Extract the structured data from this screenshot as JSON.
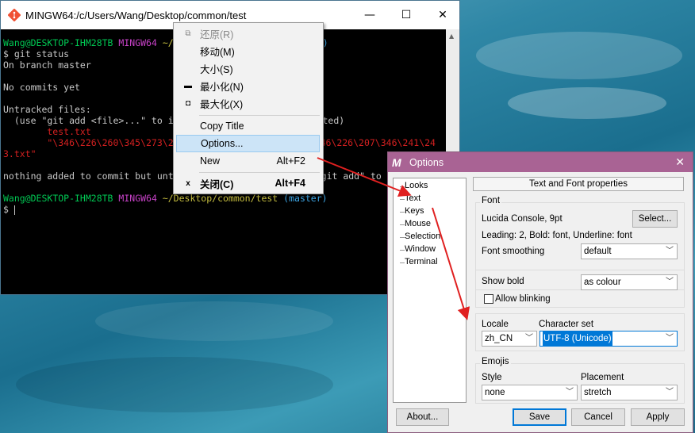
{
  "terminal": {
    "title": "MINGW64:/c/Users/Wang/Desktop/common/test",
    "prompt_user": "Wang@DESKTOP-IHM28TB",
    "prompt_sys": "MINGW64",
    "prompt_path_1": "~/",
    "prompt_path_tail": ")",
    "cmd": "$ git status",
    "l_branch": "On branch master",
    "l_nocommits": "No commits yet",
    "l_untracked": "Untracked files:",
    "l_use_prefix": "  (use \"git add <file>...\" to i",
    "l_use_suffix": "itted)",
    "l_file1": "        test.txt",
    "l_file2_a": "        \"\\346\\226\\260\\345\\273\\2",
    "l_file2_b": "346\\226\\207\\346\\241\\24",
    "l_file2_c": "3.txt\"",
    "l_nothing_a": "nothing added to commit but unt",
    "l_nothing_b": "git add\" to",
    "prompt2_path": "~/Desktop/common/test",
    "prompt2_branch": "(master)",
    "prompt2_dollar": "$ "
  },
  "menu": {
    "items": [
      {
        "icon": "restore-icon",
        "label": "还原(R)",
        "shortcut": ""
      },
      {
        "icon": "",
        "label": "移动(M)",
        "shortcut": ""
      },
      {
        "icon": "",
        "label": "大小(S)",
        "shortcut": ""
      },
      {
        "icon": "minimize-icon",
        "label": "最小化(N)",
        "shortcut": ""
      },
      {
        "icon": "maximize-icon",
        "label": "最大化(X)",
        "shortcut": ""
      },
      {
        "icon": "",
        "label": "Copy Title",
        "shortcut": ""
      },
      {
        "icon": "",
        "label": "Options...",
        "shortcut": ""
      },
      {
        "icon": "",
        "label": "New",
        "shortcut": "Alt+F2"
      },
      {
        "icon": "close-icon",
        "label": "关闭(C)",
        "shortcut": "Alt+F4"
      }
    ]
  },
  "options": {
    "title": "Options",
    "tree": [
      "Looks",
      "Text",
      "Keys",
      "Mouse",
      "Selection",
      "Window",
      "Terminal"
    ],
    "header": "Text and Font properties",
    "font_group": "Font",
    "font_name": "Lucida Console, 9pt",
    "select_btn": "Select...",
    "font_desc": "Leading: 2, Bold: font, Underline: font",
    "smoothing_label": "Font smoothing",
    "smoothing_value": "default",
    "showbold_label": "Show bold",
    "showbold_value": "as colour",
    "blink_label": "Allow blinking",
    "locale_label": "Locale",
    "locale_value": "zh_CN",
    "charset_label": "Character set",
    "charset_value": "UTF-8 (Unicode)",
    "emojis_group": "Emojis",
    "style_label": "Style",
    "style_value": "none",
    "placement_label": "Placement",
    "placement_value": "stretch",
    "about_btn": "About...",
    "save_btn": "Save",
    "cancel_btn": "Cancel",
    "apply_btn": "Apply"
  },
  "colors": {
    "annotation_arrow": "#e02020",
    "mintty_title": "#a96394",
    "highlight": "#cce4f7"
  }
}
